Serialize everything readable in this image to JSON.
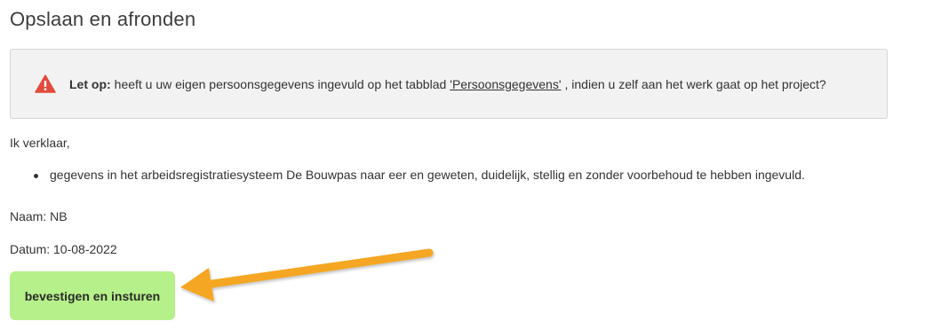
{
  "page": {
    "title": "Opslaan en afronden"
  },
  "alert": {
    "icon": "warning-icon",
    "icon_color": "#e24a3b",
    "label": "Let op:",
    "text_before": "heeft u uw eigen persoonsgegevens ingevuld op het tabblad",
    "link": "'Persoonsgegevens'",
    "text_after": ", indien u zelf aan het werk gaat op het project?"
  },
  "declaration": {
    "intro": "Ik verklaar,",
    "items": [
      "gegevens in het arbeidsregistratiesysteem De Bouwpas naar eer en geweten, duidelijk, stellig en zonder voorbehoud te hebben ingevuld."
    ]
  },
  "naam": "Naam: NB",
  "datum": "Datum: 10-08-2022",
  "confirm_button": {
    "label": "bevestigen en insturen",
    "color": "#b6f08a"
  },
  "annotation": {
    "icon": "arrow-icon",
    "color": "#f5a623"
  }
}
